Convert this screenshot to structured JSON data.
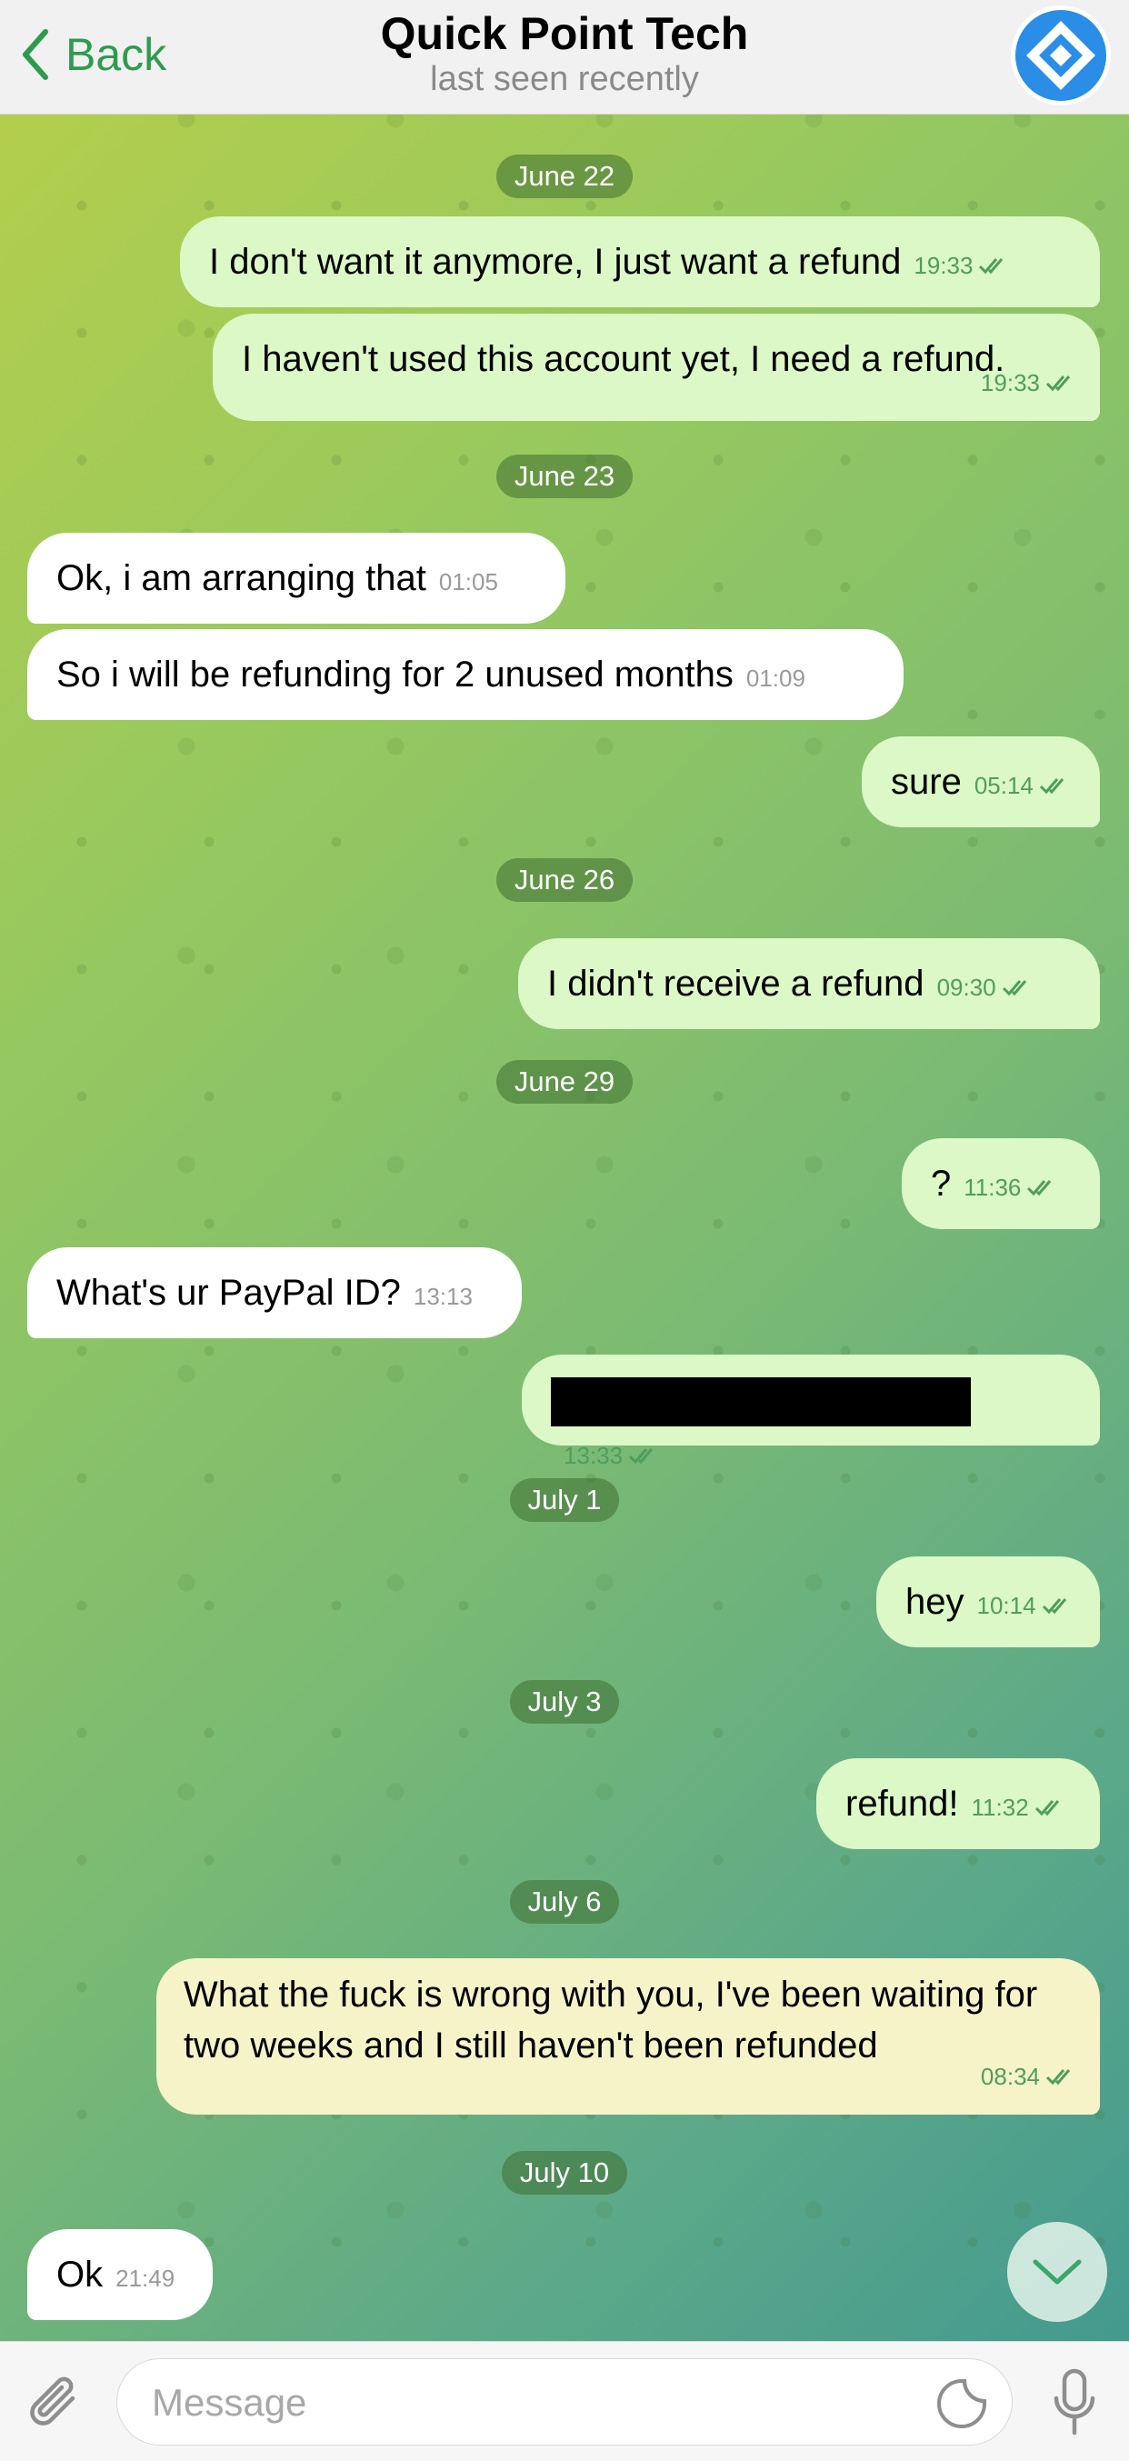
{
  "header": {
    "back_label": "Back",
    "title": "Quick Point Tech",
    "subtitle": "last seen recently"
  },
  "messages": [
    {
      "type": "date",
      "text": "June 22"
    },
    {
      "type": "out",
      "text": "I don't want it anymore, I just want a refund",
      "time": "19:33"
    },
    {
      "type": "out",
      "text": "I haven't used this account yet, I need a refund.",
      "time": "19:33"
    },
    {
      "type": "date",
      "text": "June 23"
    },
    {
      "type": "in",
      "text": "Ok, i am arranging that",
      "time": "01:05"
    },
    {
      "type": "in",
      "text": "So i will be refunding for 2 unused months",
      "time": "01:09"
    },
    {
      "type": "out",
      "text": "sure",
      "time": "05:14"
    },
    {
      "type": "date",
      "text": "June 26"
    },
    {
      "type": "out",
      "text": "I didn't receive a refund",
      "time": "09:30"
    },
    {
      "type": "date",
      "text": "June 29"
    },
    {
      "type": "out",
      "text": "?",
      "time": "11:36"
    },
    {
      "type": "in",
      "text": "What's ur PayPal ID?",
      "time": "13:13"
    },
    {
      "type": "out",
      "text": "",
      "time": "13:33",
      "redacted": true
    },
    {
      "type": "date",
      "text": "July 1"
    },
    {
      "type": "out",
      "text": "hey",
      "time": "10:14"
    },
    {
      "type": "date",
      "text": "July 3"
    },
    {
      "type": "out",
      "text": "refund!",
      "time": "11:32"
    },
    {
      "type": "date",
      "text": "July 6"
    },
    {
      "type": "out",
      "text": "What the fuck is wrong with you, I've been waiting for two weeks and I still haven't been refunded",
      "time": "08:34"
    },
    {
      "type": "date",
      "text": "July 10"
    },
    {
      "type": "in",
      "text": "Ok",
      "time": "21:49"
    }
  ],
  "composer": {
    "placeholder": "Message"
  },
  "colors": {
    "accent": "#2e9b4f",
    "outgoing_bubble": "#dcf8c6",
    "incoming_bubble": "#ffffff",
    "avatar_blue": "#2a8ee6"
  }
}
